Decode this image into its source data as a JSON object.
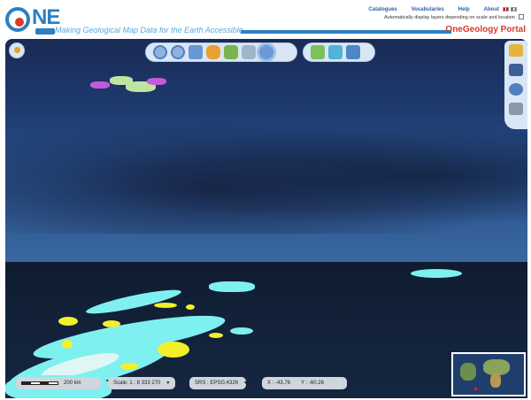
{
  "header": {
    "logo_text": "NE",
    "tagline": "Making Geological Map Data for the Earth Accessible",
    "portal_title": "OneGeology Portal",
    "nav": [
      "Catalogues",
      "Vocabularies",
      "Help",
      "About"
    ],
    "auto_layers_label": "Automatically display layers depending on scale and location"
  },
  "status": {
    "scale_distance": "200 km",
    "scale_label": "Scale: 1 : 8 333 270",
    "srs_label": "SRS : EPSG:4326",
    "x_coord": "X : -43.76",
    "y_coord": "Y : -60.26"
  },
  "colors": {
    "accent": "#2b7fc4",
    "brand_red": "#d83a2a",
    "geology_cyan": "#7ef0ef",
    "geology_yellow": "#f3f02b"
  },
  "icons": {
    "navigation": [
      "zoom-in-icon",
      "zoom-out-icon",
      "zoom-extent-icon",
      "pan-icon",
      "undo-icon",
      "redo-icon",
      "info-icon"
    ],
    "layers": [
      "add-layer-icon",
      "add-wms-icon",
      "layer-manager-icon"
    ],
    "side": [
      "folder-icon",
      "save-icon",
      "globe-icon",
      "print-icon"
    ]
  }
}
